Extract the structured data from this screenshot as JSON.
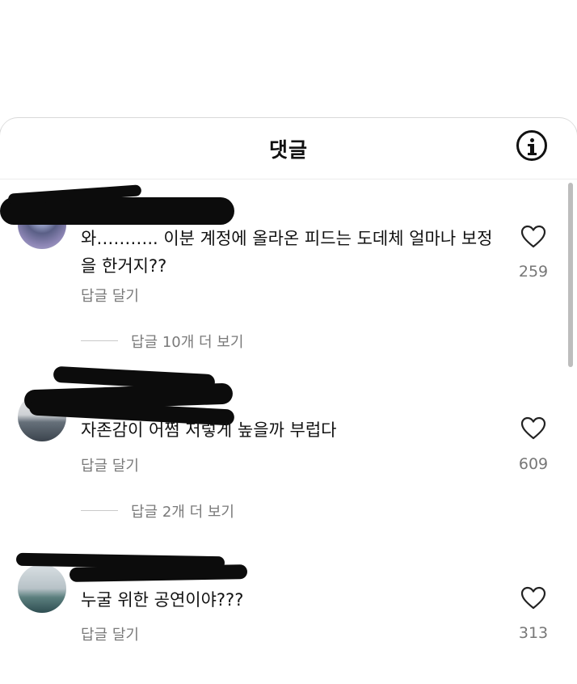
{
  "header": {
    "title": "댓글",
    "info_icon": "info-icon"
  },
  "comments": [
    {
      "text": "와……….. 이분 계정에 올라온 피드는 도데체 얼마나 보정을 한거지??",
      "reply_label": "답글 달기",
      "likes": "259",
      "more_replies": "답글 10개 더 보기"
    },
    {
      "text": "자존감이 어쩜 저렇게 높을까 부럽다",
      "reply_label": "답글 달기",
      "likes": "609",
      "more_replies": "답글 2개 더 보기"
    },
    {
      "text": "누굴 위한 공연이야???",
      "reply_label": "답글 달기",
      "likes": "313"
    }
  ],
  "colors": {
    "heart_stroke": "#222222",
    "secondary_text": "#7a7a7a",
    "redaction": "#0c0c0c"
  }
}
